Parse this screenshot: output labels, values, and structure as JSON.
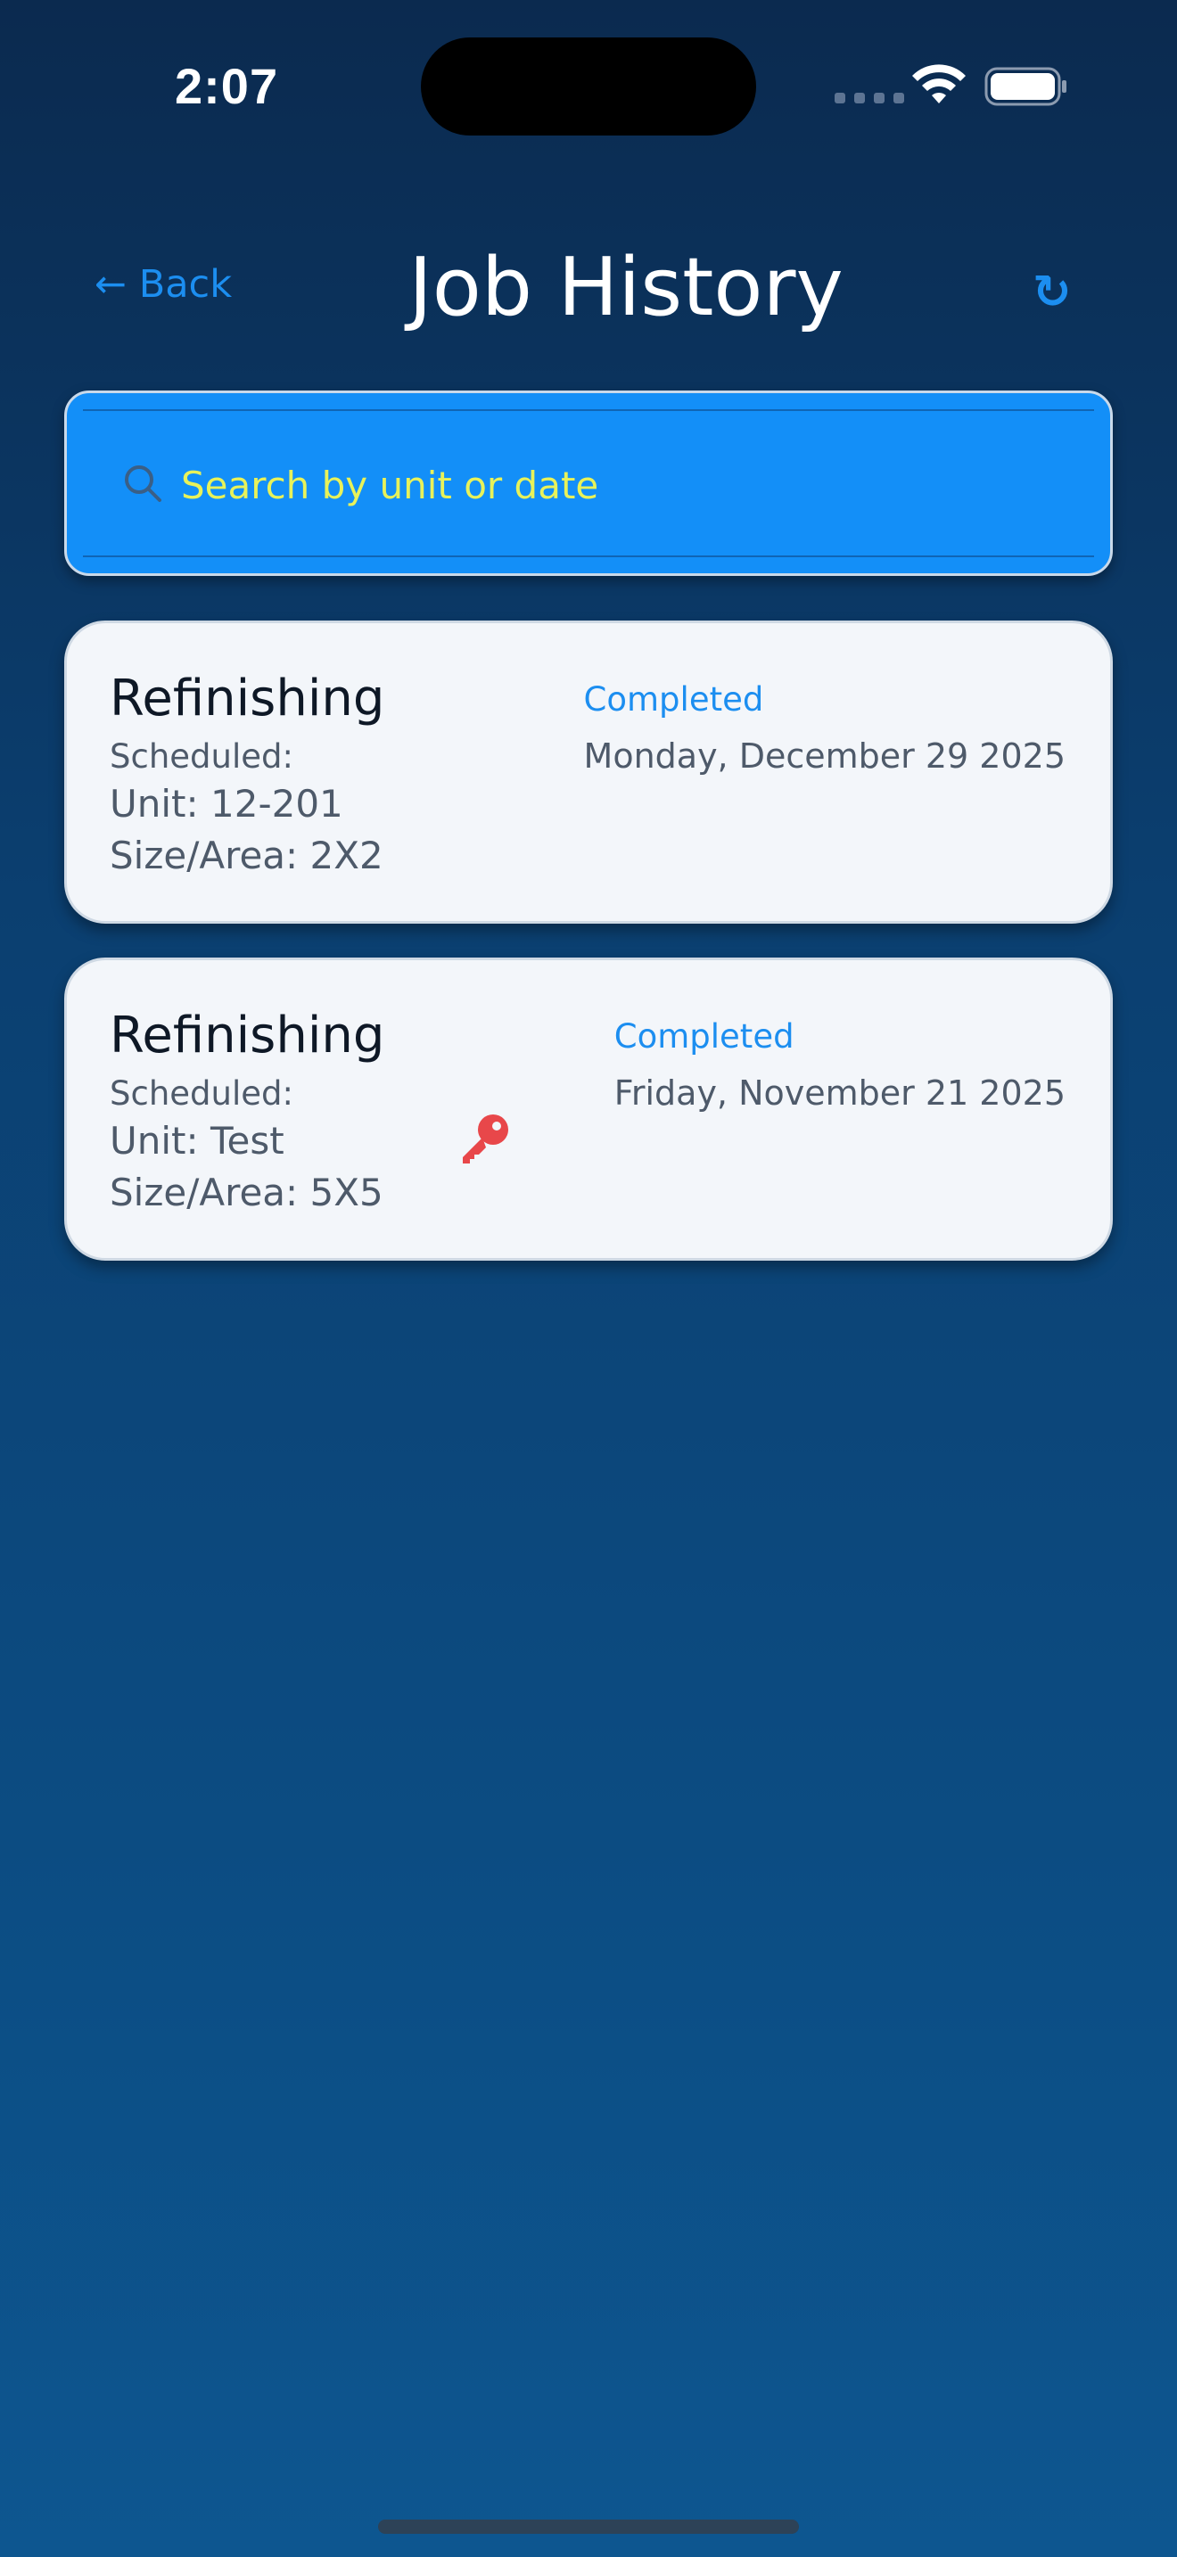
{
  "status_bar": {
    "time": "2:07"
  },
  "header": {
    "back_label": "← Back",
    "title": "Job History",
    "refresh_symbol": "↻"
  },
  "search": {
    "placeholder": "Search by unit or date",
    "value": ""
  },
  "jobs": [
    {
      "title": "Refinishing",
      "scheduled_label": "Scheduled:",
      "unit": "Unit: 12-201",
      "size": "Size/Area: 2X2",
      "status": "Completed",
      "date": "Monday, December 29 2025",
      "has_key": false
    },
    {
      "title": "Refinishing",
      "scheduled_label": "Scheduled:",
      "unit": "Unit: Test",
      "size": "Size/Area: 5X5",
      "status": "Completed",
      "date": "Friday, November 21 2025",
      "has_key": true
    }
  ],
  "colors": {
    "accent": "#1c8ef0",
    "search_background": "#138ff8",
    "search_placeholder": "#e8f25a",
    "card_background": "#f3f6fa",
    "key_icon": "#e8474a"
  },
  "icons": {
    "search": "search-icon",
    "refresh": "refresh-icon",
    "key": "key-icon",
    "wifi": "wifi-icon",
    "battery": "battery-icon"
  }
}
